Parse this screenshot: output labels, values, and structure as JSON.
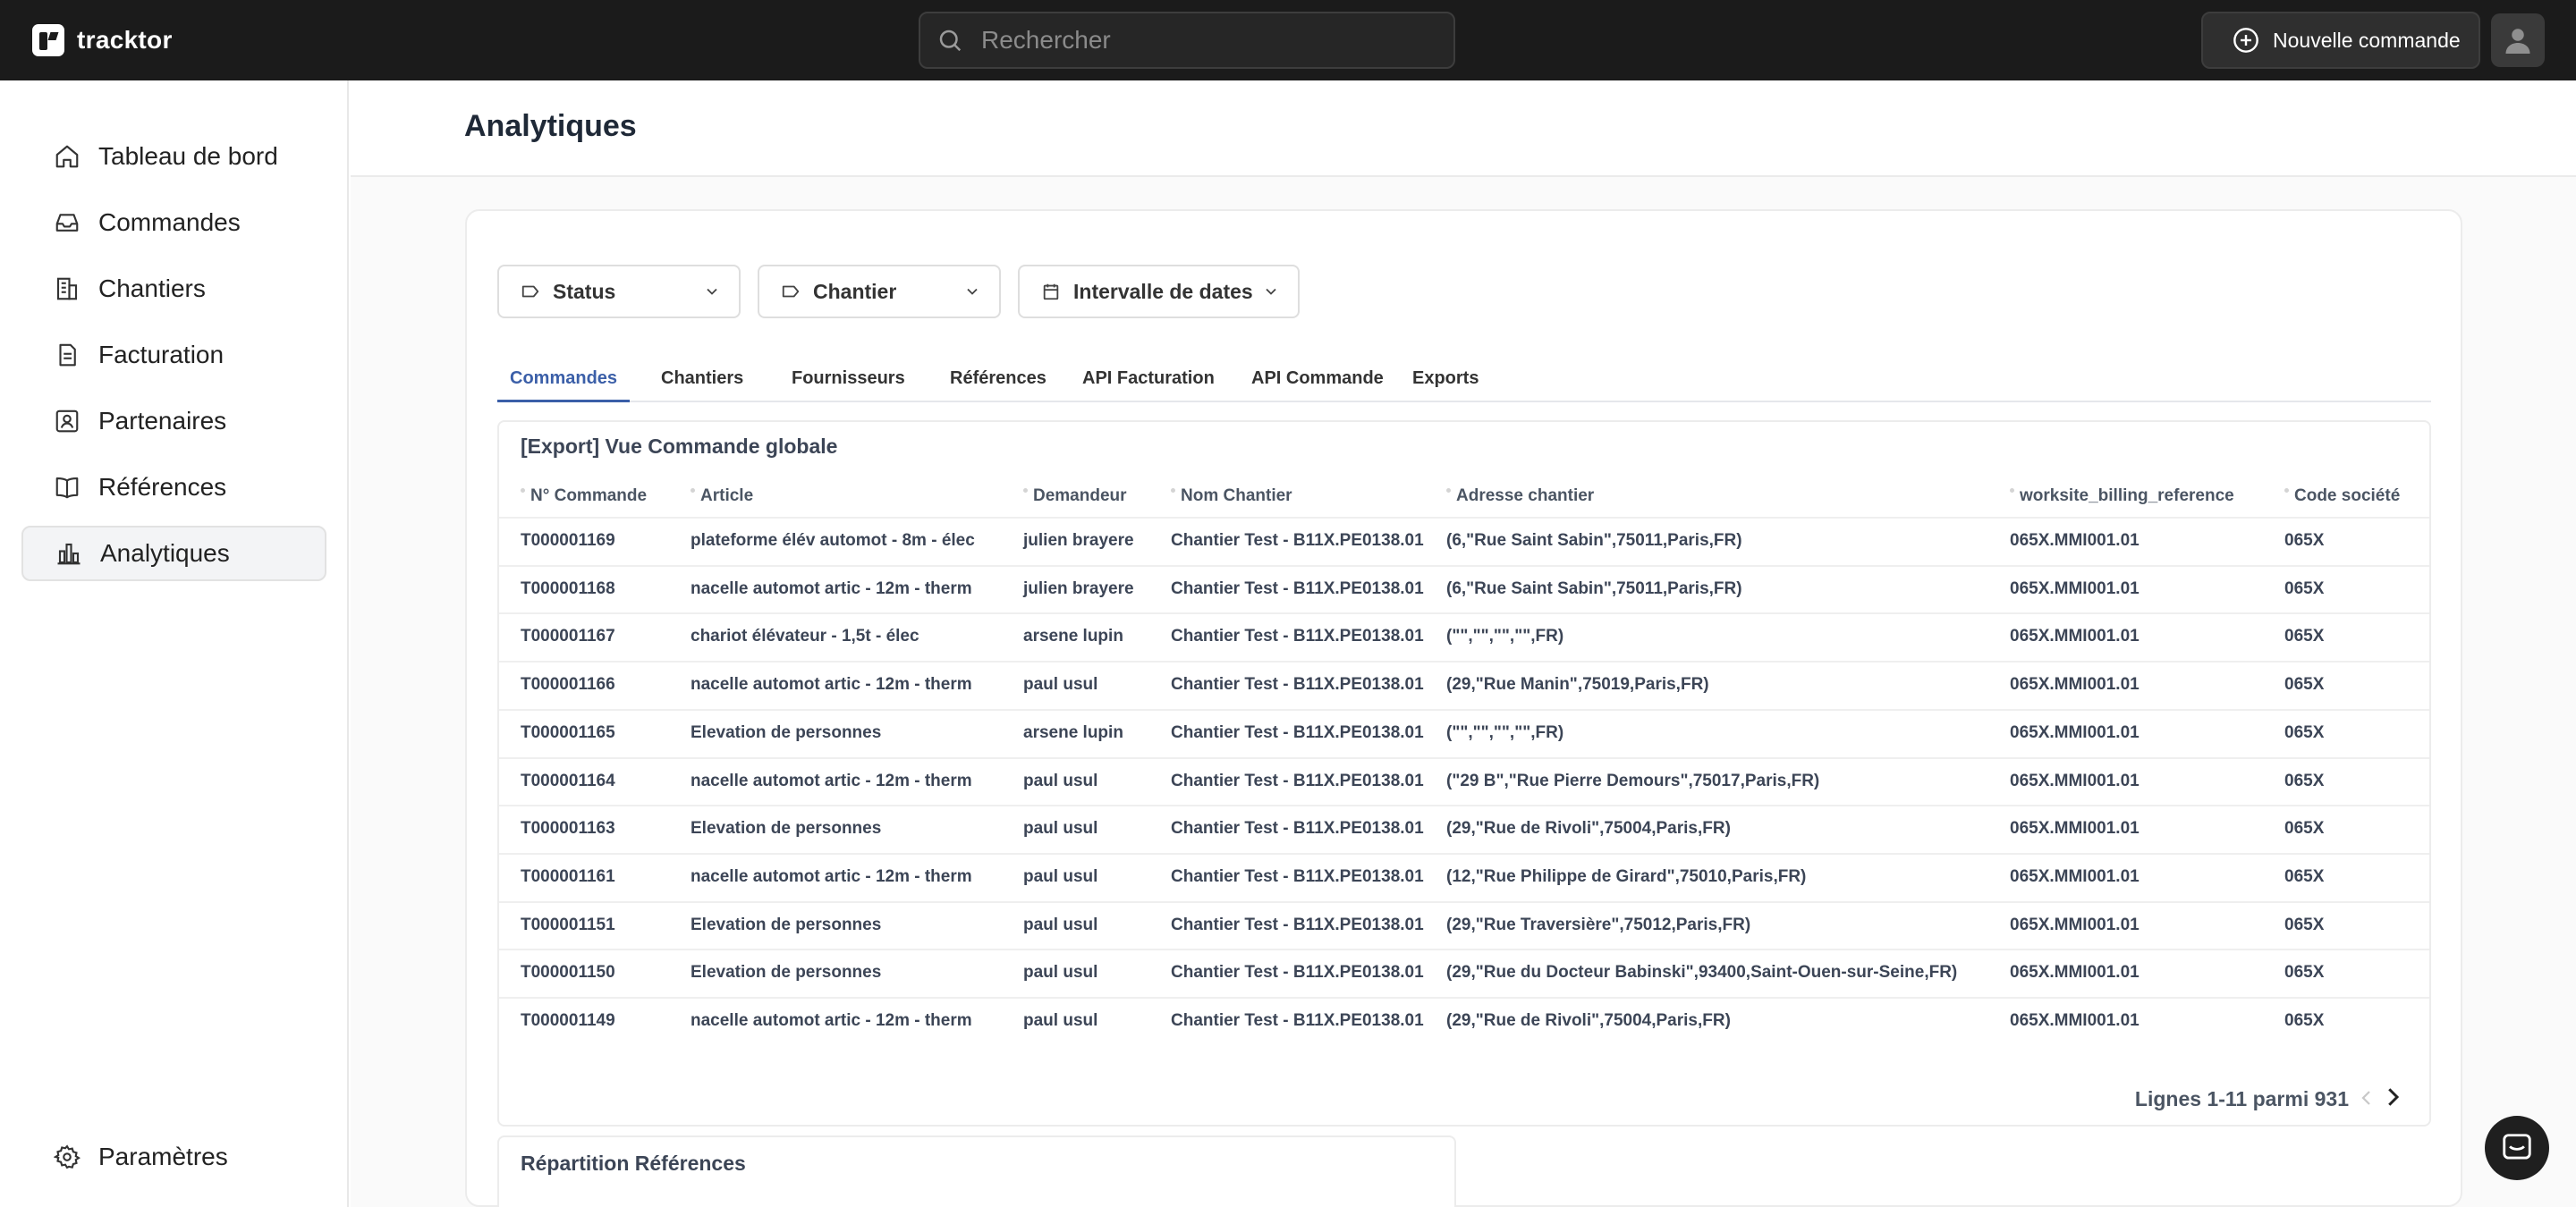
{
  "app": {
    "name": "tracktor"
  },
  "topbar": {
    "search_placeholder": "Rechercher",
    "new_order_label": "Nouvelle commande"
  },
  "sidebar": {
    "items": [
      {
        "label": "Tableau de bord",
        "icon": "home-icon"
      },
      {
        "label": "Commandes",
        "icon": "inbox-icon"
      },
      {
        "label": "Chantiers",
        "icon": "building-icon"
      },
      {
        "label": "Facturation",
        "icon": "invoice-icon"
      },
      {
        "label": "Partenaires",
        "icon": "contact-card-icon"
      },
      {
        "label": "Références",
        "icon": "book-icon"
      },
      {
        "label": "Analytiques",
        "icon": "chart-icon",
        "active": true
      }
    ],
    "settings_label": "Paramètres"
  },
  "page": {
    "title": "Analytiques"
  },
  "filters": {
    "status": "Status",
    "chantier": "Chantier",
    "date_range": "Intervalle de dates"
  },
  "tabs": [
    "Commandes",
    "Chantiers",
    "Fournisseurs",
    "Références",
    "API Facturation",
    "API Commande",
    "Exports"
  ],
  "table": {
    "title": "[Export] Vue Commande globale",
    "columns": [
      "N° Commande",
      "Article",
      "Demandeur",
      "Nom Chantier",
      "Adresse chantier",
      "worksite_billing_reference",
      "Code société"
    ],
    "rows": [
      [
        "T000001169",
        "plateforme élév automot - 8m - élec",
        "julien brayere",
        "Chantier Test - B11X.PE0138.01",
        "(6,\"Rue Saint Sabin\",75011,Paris,FR)",
        "065X.MMI001.01",
        "065X"
      ],
      [
        "T000001168",
        "nacelle automot artic - 12m - therm",
        "julien brayere",
        "Chantier Test - B11X.PE0138.01",
        "(6,\"Rue Saint Sabin\",75011,Paris,FR)",
        "065X.MMI001.01",
        "065X"
      ],
      [
        "T000001167",
        "chariot élévateur - 1,5t - élec",
        "arsene lupin",
        "Chantier Test - B11X.PE0138.01",
        "(\"\",\"\",\"\",\"\",FR)",
        "065X.MMI001.01",
        "065X"
      ],
      [
        "T000001166",
        "nacelle automot artic - 12m - therm",
        "paul usul",
        "Chantier Test - B11X.PE0138.01",
        "(29,\"Rue Manin\",75019,Paris,FR)",
        "065X.MMI001.01",
        "065X"
      ],
      [
        "T000001165",
        "Elevation de personnes",
        "arsene lupin",
        "Chantier Test - B11X.PE0138.01",
        "(\"\",\"\",\"\",\"\",FR)",
        "065X.MMI001.01",
        "065X"
      ],
      [
        "T000001164",
        "nacelle automot artic - 12m - therm",
        "paul usul",
        "Chantier Test - B11X.PE0138.01",
        "(\"29 B\",\"Rue Pierre Demours\",75017,Paris,FR)",
        "065X.MMI001.01",
        "065X"
      ],
      [
        "T000001163",
        "Elevation de personnes",
        "paul usul",
        "Chantier Test - B11X.PE0138.01",
        "(29,\"Rue de Rivoli\",75004,Paris,FR)",
        "065X.MMI001.01",
        "065X"
      ],
      [
        "T000001161",
        "nacelle automot artic - 12m - therm",
        "paul usul",
        "Chantier Test - B11X.PE0138.01",
        "(12,\"Rue Philippe de Girard\",75010,Paris,FR)",
        "065X.MMI001.01",
        "065X"
      ],
      [
        "T000001151",
        "Elevation de personnes",
        "paul usul",
        "Chantier Test - B11X.PE0138.01",
        "(29,\"Rue Traversière\",75012,Paris,FR)",
        "065X.MMI001.01",
        "065X"
      ],
      [
        "T000001150",
        "Elevation de personnes",
        "paul usul",
        "Chantier Test - B11X.PE0138.01",
        "(29,\"Rue du Docteur Babinski\",93400,Saint-Ouen-sur-Seine,FR)",
        "065X.MMI001.01",
        "065X"
      ],
      [
        "T000001149",
        "nacelle automot artic - 12m - therm",
        "paul usul",
        "Chantier Test - B11X.PE0138.01",
        "(29,\"Rue de Rivoli\",75004,Paris,FR)",
        "065X.MMI001.01",
        "065X"
      ]
    ],
    "pagination": "Lignes 1-11 parmi 931"
  },
  "bottom_section": {
    "title": "Répartition Références"
  },
  "colors": {
    "topbar": "#1b1b1b",
    "accent": "#3b5fa8",
    "text": "#3c4556"
  }
}
